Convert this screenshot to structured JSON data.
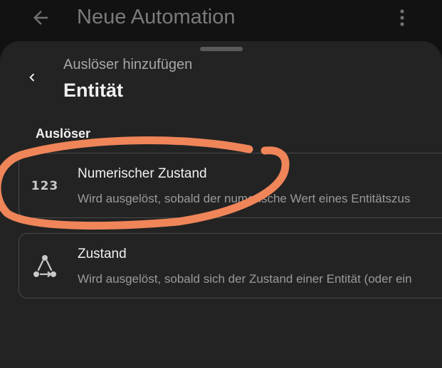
{
  "appbar": {
    "title": "Neue Automation",
    "back_icon": "arrow-left-icon",
    "menu_icon": "more-vertical-icon"
  },
  "sheet": {
    "subtitle": "Auslöser hinzufügen",
    "title": "Entität",
    "back_icon": "chevron-left-icon",
    "section_label": "Auslöser",
    "items": [
      {
        "icon": "numeric-123-icon",
        "icon_text": "123",
        "title": "Numerischer Zustand",
        "description": "Wird ausgelöst, sobald der numerische Wert eines Entitätszus"
      },
      {
        "icon": "state-graph-icon",
        "title": "Zustand",
        "description": "Wird ausgelöst, sobald sich der Zustand einer Entität (oder ein"
      }
    ]
  },
  "colors": {
    "background": "#111111",
    "sheet": "#232323",
    "card_border": "#4a4a4a",
    "annotation": "#ef8559"
  }
}
